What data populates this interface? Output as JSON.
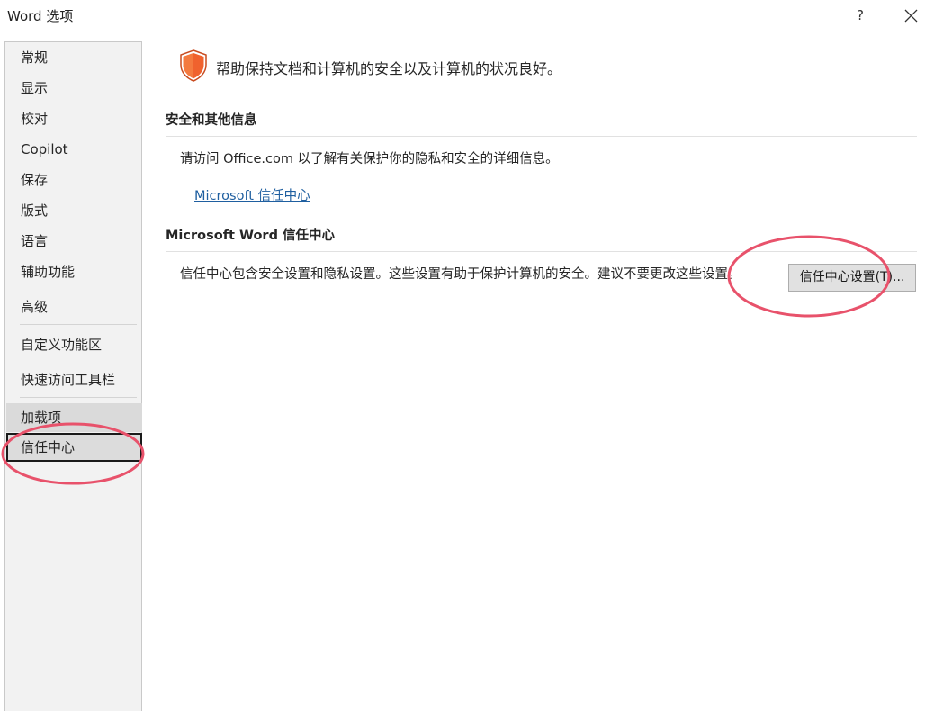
{
  "window": {
    "title": "Word 选项",
    "help_label": "?"
  },
  "sidebar": {
    "items": [
      {
        "label": "常规"
      },
      {
        "label": "显示"
      },
      {
        "label": "校对"
      },
      {
        "label": "Copilot"
      },
      {
        "label": "保存"
      },
      {
        "label": "版式"
      },
      {
        "label": "语言"
      },
      {
        "label": "辅助功能"
      },
      {
        "label": "高级"
      },
      {
        "label": "自定义功能区"
      },
      {
        "label": "快速访问工具栏"
      },
      {
        "label": "加载项"
      },
      {
        "label": "信任中心"
      }
    ],
    "selected": "信任中心"
  },
  "main": {
    "header": "帮助保持文档和计算机的安全以及计算机的状况良好。",
    "security_section": {
      "heading": "安全和其他信息",
      "text": "请访问 Office.com  以了解有关保护你的隐私和安全的详细信息。",
      "link": "Microsoft 信任中心"
    },
    "trust_center_section": {
      "heading": "Microsoft Word 信任中心",
      "text": "信任中心包含安全设置和隐私设置。这些设置有助于保护计算机的安全。建议不要更改这些设置。",
      "button_label": "信任中心设置(T)..."
    }
  },
  "colors": {
    "shield": "#f0622e",
    "link": "#1f5fa0",
    "annotation": "#e8526b"
  }
}
